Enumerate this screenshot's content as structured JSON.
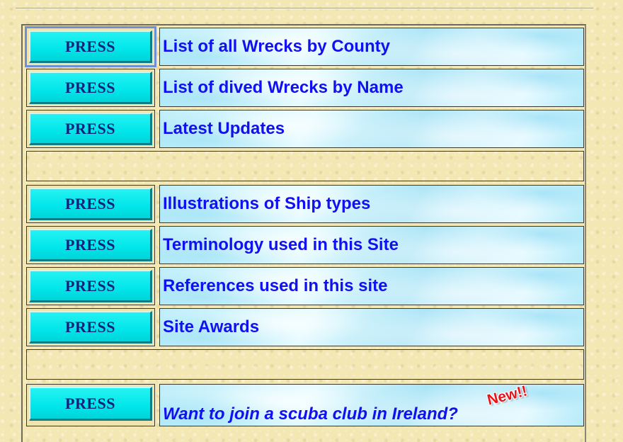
{
  "menu": {
    "button_label": "PRESS",
    "items": [
      {
        "label": "List of all Wrecks by County"
      },
      {
        "label": "List of dived Wrecks by Name"
      },
      {
        "label": "Latest Updates"
      },
      {
        "label": "Illustrations of Ship types"
      },
      {
        "label": "Terminology used in this Site"
      },
      {
        "label": "References used in this site"
      },
      {
        "label": "Site Awards"
      },
      {
        "label": "Want to join a scuba club in Ireland?",
        "badge": "New!!"
      }
    ]
  }
}
